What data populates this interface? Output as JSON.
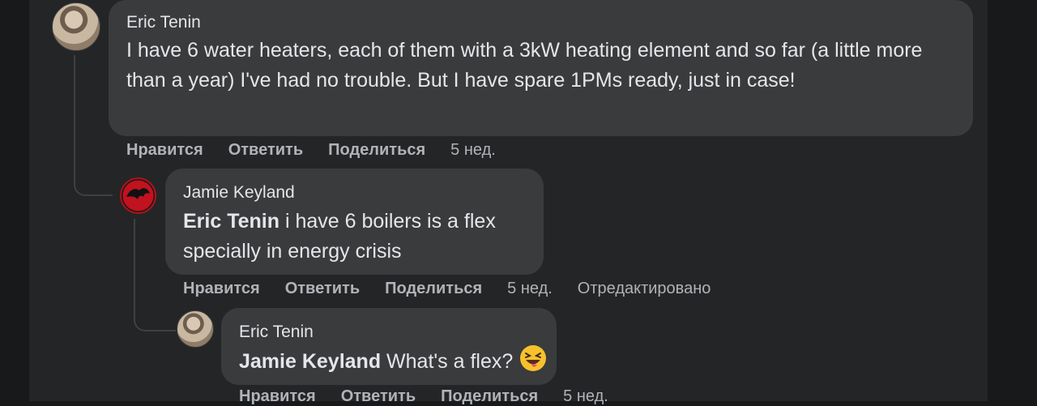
{
  "comments": [
    {
      "author": "Eric Tenin",
      "text": "I have 6 water heaters, each of them with a 3kW heating element and so far (a little more than a year) I've had no trouble. But I have spare 1PMs ready, just in case!",
      "actions": {
        "like": "Нравится",
        "reply": "Ответить",
        "share": "Поделиться",
        "time": "5 нед."
      }
    },
    {
      "author": "Jamie Keyland",
      "mention": "Eric Tenin",
      "text": " i have 6 boilers is a flex specially in energy crisis",
      "actions": {
        "like": "Нравится",
        "reply": "Ответить",
        "share": "Поделиться",
        "time": "5 нед.",
        "edited": "Отредактировано"
      }
    },
    {
      "author": "Eric Tenin",
      "mention": "Jamie Keyland",
      "text": " What's a flex?",
      "emoji": "grinning-squinting-tongue-emoji",
      "actions": {
        "like": "Нравится",
        "reply": "Ответить",
        "share": "Поделиться",
        "time": "5 нед."
      }
    }
  ],
  "colors": {
    "background": "#18191a",
    "panel": "#242526",
    "bubble": "#3a3b3c",
    "text": "#e4e6eb",
    "secondary": "#b0b3b8"
  }
}
